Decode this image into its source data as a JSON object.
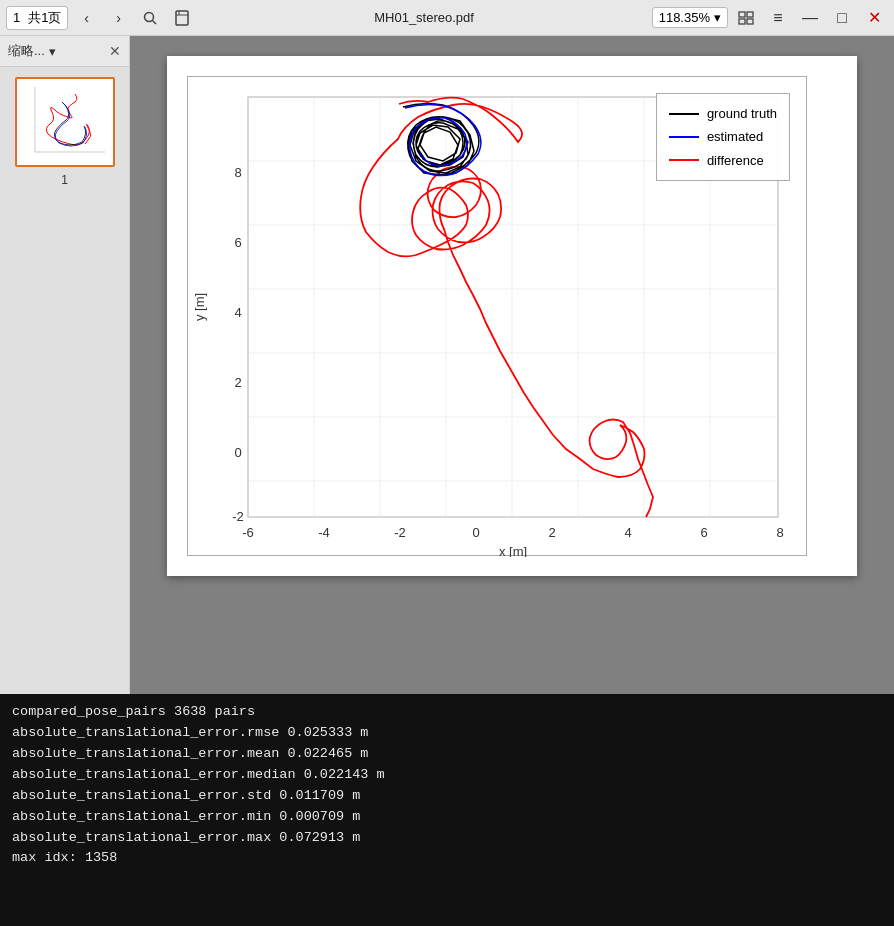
{
  "toolbar": {
    "page_current": "1",
    "page_total": "共1页",
    "btn_prev": "‹",
    "btn_next": "›",
    "btn_search": "🔍",
    "btn_bookmark": "🔖",
    "title": "MH01_stereo.pdf",
    "zoom": "118.35%",
    "btn_menu": "≡",
    "btn_minimize": "—",
    "btn_restore": "□",
    "btn_close": "✕"
  },
  "sidebar": {
    "label": "缩略...",
    "close": "✕",
    "thumbnail_page": "1"
  },
  "chart": {
    "x_label": "x [m]",
    "y_label": "y [m]",
    "x_ticks": [
      "-6",
      "-4",
      "-2",
      "0",
      "2",
      "4",
      "6",
      "8"
    ],
    "y_ticks": [
      "-2",
      "0",
      "2",
      "4",
      "6",
      "8"
    ],
    "legend": [
      {
        "label": "ground truth",
        "color": "#000000"
      },
      {
        "label": "estimated",
        "color": "#0000ff"
      },
      {
        "label": "difference",
        "color": "#ff0000"
      }
    ]
  },
  "terminal": {
    "lines": [
      {
        "key": "compared_pose_pairs",
        "value": "3638 pairs"
      },
      {
        "key": "absolute_translational_error.rmse",
        "value": "0.025333 m"
      },
      {
        "key": "absolute_translational_error.mean",
        "value": "0.022465 m"
      },
      {
        "key": "absolute_translational_error.median",
        "value": "0.022143 m"
      },
      {
        "key": "absolute_translational_error.std",
        "value": "0.011709 m"
      },
      {
        "key": "absolute_translational_error.min",
        "value": "0.000709 m"
      },
      {
        "key": "absolute_translational_error.max",
        "value": "0.072913 m"
      },
      {
        "key": "max idx:",
        "value": "1358"
      }
    ]
  }
}
